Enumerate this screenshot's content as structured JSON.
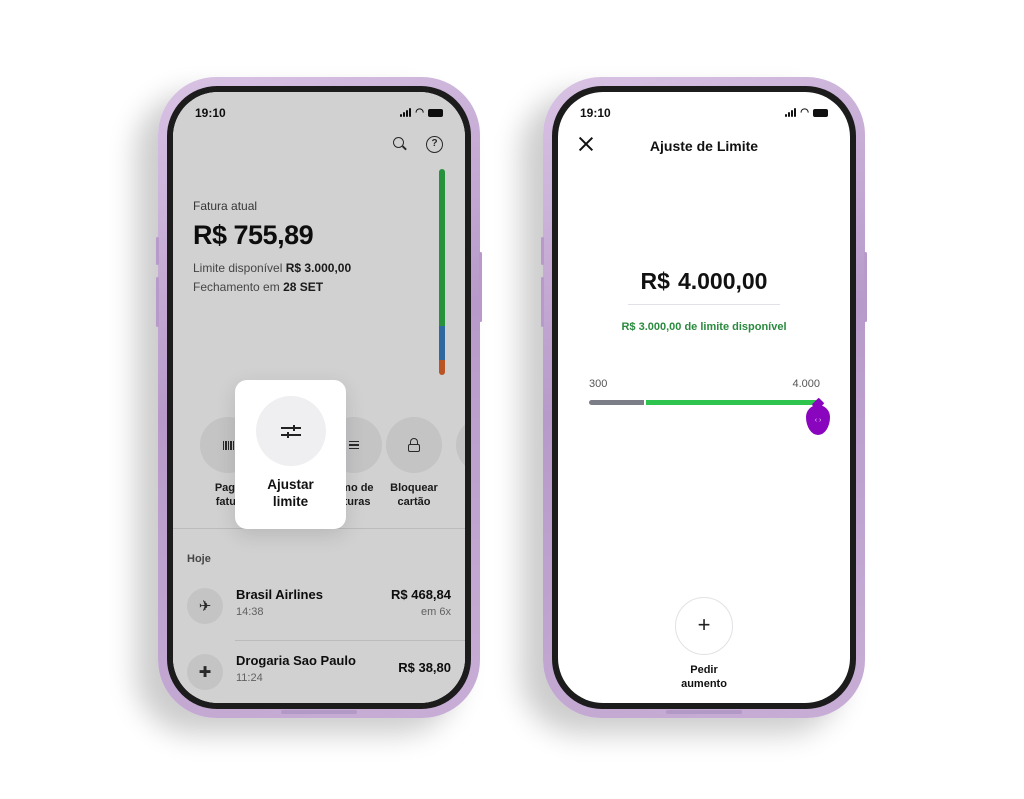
{
  "phone1": {
    "status": {
      "time": "19:10"
    },
    "header": {
      "search_icon": "search-icon",
      "help_icon": "help-icon",
      "help_glyph": "?"
    },
    "fatura": {
      "label": "Fatura atual",
      "value": "R$ 755,89",
      "limit_prefix": "Limite disponível",
      "limit_value": "R$ 3.000,00",
      "closing_prefix": "Fechamento em",
      "closing_value": "28 SET"
    },
    "actions": [
      {
        "label_line1": "Paga",
        "label_line2": "fatur",
        "icon": "barcode-icon"
      },
      {
        "label_line1": "umo de",
        "label_line2": "aturas",
        "icon": "list-icon"
      },
      {
        "label_line1": "Bloquear",
        "label_line2": "cartão",
        "icon": "lock-icon"
      }
    ],
    "popup": {
      "label_line1": "Ajustar",
      "label_line2": "limite",
      "icon": "sliders-icon"
    },
    "transactions_header": "Hoje",
    "transactions": [
      {
        "name": "Brasil Airlines",
        "time": "14:38",
        "amount": "R$ 468,84",
        "installments": "em 6x",
        "icon": "airplane-icon"
      },
      {
        "name": "Drogaria Sao Paulo",
        "time": "11:24",
        "amount": "R$ 38,80",
        "installments": "",
        "icon": "medical-cross-icon"
      }
    ],
    "colors": {
      "bar_green": "#2fb34a",
      "bar_blue": "#3b7fc4",
      "bar_orange": "#e4672c"
    }
  },
  "phone2": {
    "status": {
      "time": "19:10"
    },
    "title": "Ajuste de Limite",
    "amount_currency": "R$",
    "amount_value": "4.000,00",
    "available_text": "R$ 3.000,00 de limite disponível",
    "slider": {
      "min_label": "300",
      "max_label": "4.000",
      "thumb_glyph": "‹ ›"
    },
    "request_button": {
      "glyph": "+",
      "label_line1": "Pedir",
      "label_line2": "aumento"
    },
    "colors": {
      "accent": "#8a05be",
      "available_green": "#2ec44d",
      "used_gray": "#7b7d87",
      "available_text": "#2a8a3e"
    }
  }
}
